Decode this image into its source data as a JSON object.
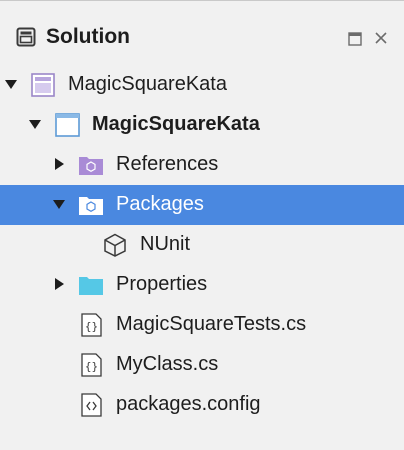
{
  "header": {
    "title": "Solution",
    "solution_icon": "solution-window-icon",
    "pad_icon": "pad-options-icon",
    "close_icon": "close-icon"
  },
  "tree": {
    "solution": {
      "label": "MagicSquareKata",
      "icon": "solution-icon",
      "expanded": true
    },
    "project": {
      "label": "MagicSquareKata",
      "icon": "project-icon",
      "expanded": true
    },
    "references": {
      "label": "References",
      "icon": "references-folder-icon",
      "expanded": false
    },
    "packages": {
      "label": "Packages",
      "icon": "packages-folder-icon",
      "expanded": true,
      "selected": true
    },
    "nunit": {
      "label": "NUnit",
      "icon": "package-cube-icon"
    },
    "properties": {
      "label": "Properties",
      "icon": "folder-icon",
      "expanded": false
    },
    "tests_file": {
      "label": "MagicSquareTests.cs",
      "icon": "csharp-file-icon"
    },
    "myclass_file": {
      "label": "MyClass.cs",
      "icon": "csharp-file-icon"
    },
    "config_file": {
      "label": "packages.config",
      "icon": "config-file-icon"
    }
  },
  "colors": {
    "selection": "#4a88e0",
    "folder_blue": "#55c8e6",
    "references_purple": "#a98bd6",
    "solution_purple": "#9a86c8"
  }
}
